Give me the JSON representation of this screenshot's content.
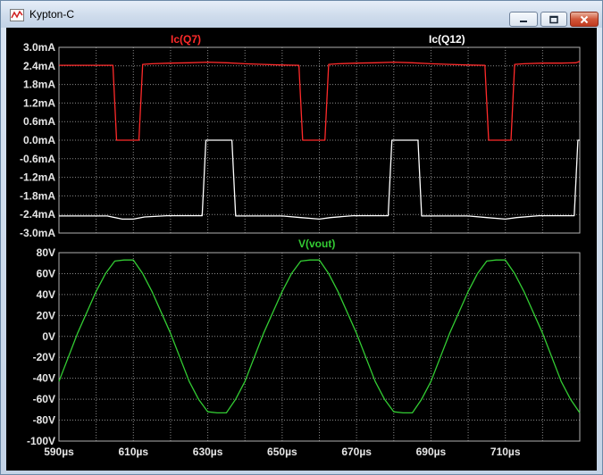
{
  "window": {
    "title": "Kypton-C",
    "icon": "waveform-icon",
    "controls": [
      "minimize-icon",
      "maximize-icon",
      "close-icon"
    ]
  },
  "colors": {
    "background": "#000000",
    "ic_q7": "#ff2a2a",
    "ic_q12": "#ffffff",
    "vout": "#33cc33",
    "grid": "#8a8a8a"
  },
  "chart_data": [
    {
      "type": "line",
      "title": "",
      "xlabel": "",
      "ylabel": "",
      "ylim": [
        -3.0,
        3.0
      ],
      "xlim": [
        590,
        730
      ],
      "yticks": [
        "3.0mA",
        "2.4mA",
        "1.8mA",
        "1.2mA",
        "0.6mA",
        "0.0mA",
        "-0.6mA",
        "-1.2mA",
        "-1.8mA",
        "-2.4mA",
        "-3.0mA"
      ],
      "ytick_values": [
        3.0,
        2.4,
        1.8,
        1.2,
        0.6,
        0.0,
        -0.6,
        -1.2,
        -1.8,
        -2.4,
        -3.0
      ],
      "grid": true,
      "series": [
        {
          "name": "Ic(Q7)",
          "color": "#ff2a2a",
          "x": [
            590,
            604.5,
            605.5,
            611.5,
            612.5,
            615,
            620,
            625,
            630,
            635,
            640,
            645,
            650,
            654.5,
            655.5,
            661.5,
            662.5,
            665,
            670,
            675,
            680,
            685,
            690,
            695,
            700,
            704.5,
            705.5,
            711.5,
            712.5,
            715,
            720,
            725,
            729,
            730
          ],
          "y": [
            2.42,
            2.42,
            0.0,
            0.0,
            2.45,
            2.47,
            2.49,
            2.5,
            2.52,
            2.5,
            2.47,
            2.45,
            2.43,
            2.42,
            0.0,
            0.0,
            2.45,
            2.47,
            2.49,
            2.5,
            2.52,
            2.5,
            2.47,
            2.45,
            2.43,
            2.42,
            0.0,
            0.0,
            2.45,
            2.47,
            2.49,
            2.49,
            2.5,
            2.55
          ]
        },
        {
          "name": "Ic(Q12)",
          "color": "#ffffff",
          "x": [
            590,
            603,
            607,
            610,
            613,
            619,
            628.5,
            629.5,
            636.5,
            637.5,
            645,
            650,
            655,
            660,
            663,
            669,
            678.5,
            679.5,
            686.5,
            687.5,
            695,
            700,
            705,
            710,
            713,
            719,
            728.5,
            729.5,
            730
          ],
          "y": [
            -2.45,
            -2.45,
            -2.55,
            -2.55,
            -2.48,
            -2.44,
            -2.44,
            0.0,
            0.0,
            -2.45,
            -2.45,
            -2.45,
            -2.5,
            -2.55,
            -2.5,
            -2.44,
            -2.44,
            0.0,
            0.0,
            -2.45,
            -2.45,
            -2.45,
            -2.5,
            -2.55,
            -2.5,
            -2.44,
            -2.44,
            0.0,
            0.0
          ]
        }
      ]
    },
    {
      "type": "line",
      "title": "",
      "xlabel": "",
      "ylabel": "",
      "ylim": [
        -100,
        80
      ],
      "xlim": [
        590,
        730
      ],
      "yticks": [
        "80V",
        "60V",
        "40V",
        "20V",
        "0V",
        "-20V",
        "-40V",
        "-60V",
        "-80V",
        "-100V"
      ],
      "ytick_values": [
        80,
        60,
        40,
        20,
        0,
        -20,
        -40,
        -60,
        -80,
        -100
      ],
      "xticks": [
        "590µs",
        "610µs",
        "630µs",
        "650µs",
        "670µs",
        "690µs",
        "710µs"
      ],
      "xtick_values": [
        590,
        610,
        630,
        650,
        670,
        690,
        710
      ],
      "grid": true,
      "series": [
        {
          "name": "V(vout)",
          "color": "#33cc33",
          "period_us": 50,
          "amplitude_v": 73,
          "x": [
            590,
            595,
            600,
            602.5,
            605,
            607.5,
            610,
            612.5,
            615,
            620,
            625,
            627.5,
            630,
            632.5,
            635,
            637.5,
            640,
            645,
            650,
            652.5,
            655,
            657.5,
            660,
            662.5,
            665,
            670,
            675,
            677.5,
            680,
            682.5,
            685,
            687.5,
            690,
            695,
            700,
            702.5,
            705,
            707.5,
            710,
            712.5,
            715,
            720,
            725,
            727.5,
            730
          ],
          "y": [
            -43,
            3,
            43,
            60,
            72,
            73,
            73,
            60,
            43,
            3,
            -43,
            -60,
            -72,
            -73,
            -73,
            -60,
            -43,
            3,
            43,
            60,
            72,
            73,
            73,
            60,
            43,
            3,
            -43,
            -60,
            -72,
            -73,
            -73,
            -60,
            -43,
            3,
            43,
            60,
            72,
            73,
            73,
            60,
            43,
            3,
            -43,
            -60,
            -73
          ]
        }
      ]
    }
  ]
}
